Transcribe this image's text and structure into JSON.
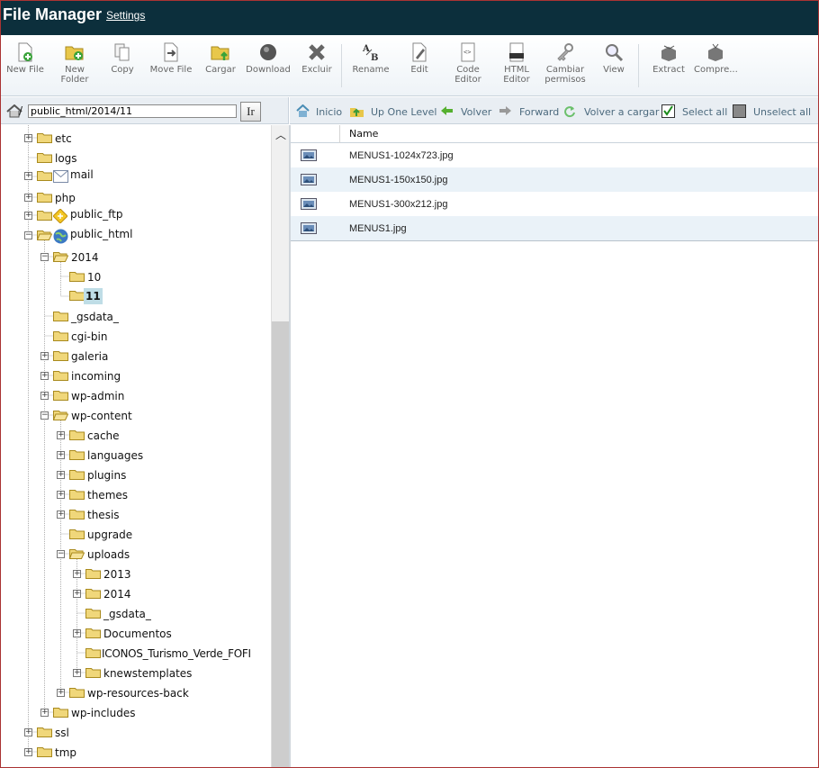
{
  "header": {
    "title": "File Manager",
    "settings": "Settings"
  },
  "toolbar": {
    "new_file": "New File",
    "new_folder_1": "New",
    "new_folder_2": "Folder",
    "copy": "Copy",
    "move_file": "Move File",
    "upload": "Cargar",
    "download": "Download",
    "delete": "Excluir",
    "rename": "Rename",
    "edit": "Edit",
    "code_editor_1": "Code",
    "code_editor_2": "Editor",
    "html_editor_1": "HTML",
    "html_editor_2": "Editor",
    "permissions_1": "Cambiar",
    "permissions_2": "permisos",
    "view": "View",
    "extract": "Extract",
    "compress": "Compre..."
  },
  "path": {
    "value": "public_html/2014/11",
    "go": "Ir"
  },
  "nav": {
    "home": "Inicio",
    "up": "Up One Level",
    "back": "Volver",
    "forward": "Forward",
    "reload": "Volver a cargar",
    "select_all": "Select all",
    "unselect_all": "Unselect all"
  },
  "tree": {
    "etc": "etc",
    "logs": "logs",
    "mail": "mail",
    "php": "php",
    "public_ftp": "public_ftp",
    "public_html": "public_html",
    "y2014": "2014",
    "m10": "10",
    "m11": "11",
    "gsdata": "_gsdata_",
    "cgi_bin": "cgi-bin",
    "galeria": "galeria",
    "incoming": "incoming",
    "wp_admin": "wp-admin",
    "wp_content": "wp-content",
    "cache": "cache",
    "languages": "languages",
    "plugins": "plugins",
    "themes": "themes",
    "thesis": "thesis",
    "upgrade": "upgrade",
    "uploads": "uploads",
    "u2013": "2013",
    "u2014": "2014",
    "ugsdata": "_gsdata_",
    "documentos": "Documentos",
    "iconos": "ICONOS_Turismo_Verde_FOFI",
    "knews": "knewstemplates",
    "wp_resources": "wp-resources-back",
    "wp_includes": "wp-includes",
    "ssl": "ssl",
    "tmp": "tmp"
  },
  "files": {
    "column_name": "Name",
    "rows": [
      "MENUS1-1024x723.jpg",
      "MENUS1-150x150.jpg",
      "MENUS1-300x212.jpg",
      "MENUS1.jpg"
    ]
  }
}
